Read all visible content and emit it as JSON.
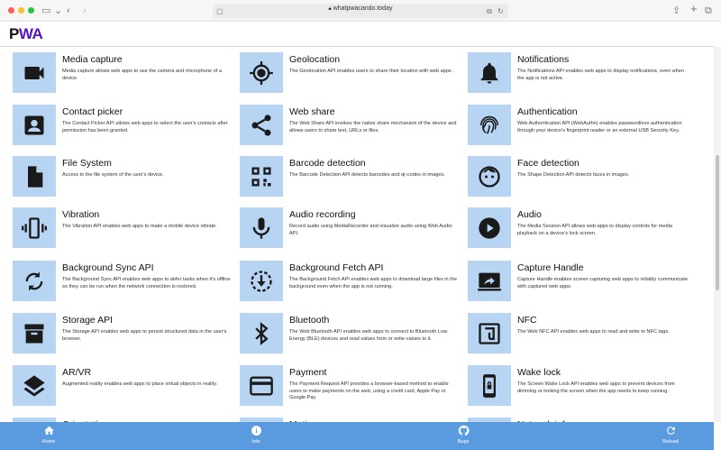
{
  "browser": {
    "url": "whatpwacando.today"
  },
  "app": {
    "logo_text_a": "P",
    "logo_text_b": "WA"
  },
  "colors": {
    "tile_bg": "#b7d5f3",
    "bottom_nav_bg": "#5a9be0",
    "icon": "#1a1a1a"
  },
  "features": [
    {
      "title": "Media capture",
      "desc": "Media capture allows web apps to use the camera and microphone of a device",
      "icon": "videocam-icon"
    },
    {
      "title": "Geolocation",
      "desc": "The Geolocation API enables users to share their location with web apps .",
      "icon": "gps-icon"
    },
    {
      "title": "Notifications",
      "desc": "The Notifications API enables web apps to display notifications, even when the app is not active.",
      "icon": "bell-icon"
    },
    {
      "title": "Contact picker",
      "desc": "The Contact Picker API allows web apps to select the user's contacts after permission has been granted.",
      "icon": "contact-icon"
    },
    {
      "title": "Web share",
      "desc": "The Web Share API invokes the native share mechanism of the device and allows users to share text, URLs or files.",
      "icon": "share-icon"
    },
    {
      "title": "Authentication",
      "desc": "Web Authentication API (WebAuthn) enables passwordless authentication through your device's fingerprint reader or an external USB Security Key.",
      "icon": "fingerprint-icon"
    },
    {
      "title": "File System",
      "desc": "Access to the file system of the user's device.",
      "icon": "file-icon"
    },
    {
      "title": "Barcode detection",
      "desc": "The Barcode Detection API detects barcodes and qr-codes in images.",
      "icon": "qr-code-icon"
    },
    {
      "title": "Face detection",
      "desc": "The Shape Detection API detects faces in images.",
      "icon": "face-icon"
    },
    {
      "title": "Vibration",
      "desc": "The Vibration API enables web apps to make a mobile device vibrate.",
      "icon": "vibration-icon"
    },
    {
      "title": "Audio recording",
      "desc": "Record audio using MediaRecorder and visualize audio using Web Audio API.",
      "icon": "microphone-icon"
    },
    {
      "title": "Audio",
      "desc": "The Media Session API allows web apps to display controls for media playback on a device's lock screen.",
      "icon": "play-icon"
    },
    {
      "title": "Background Sync API",
      "desc": "The Background Sync API enables web apps to defer tasks when it's offline so they can be run when the network connection is restored.",
      "icon": "sync-icon"
    },
    {
      "title": "Background Fetch API",
      "desc": "The Background Fetch API enables web apps to download large files in the background even when the app is not running.",
      "icon": "download-icon"
    },
    {
      "title": "Capture Handle",
      "desc": "Capture Handle enables screen capturing web apps to reliably communicate with captured web apps.",
      "icon": "screen-share-icon"
    },
    {
      "title": "Storage API",
      "desc": "The Storage API enables web apps to persist structured data in the user's browser.",
      "icon": "archive-icon"
    },
    {
      "title": "Bluetooth",
      "desc": "The Web Bluetooth API enables web apps to connect to Bluetooth Low Energy (BLE) devices and read values from or write values to it.",
      "icon": "bluetooth-icon"
    },
    {
      "title": "NFC",
      "desc": "The Web NFC API enables web apps to read and write to NFC tags.",
      "icon": "nfc-icon"
    },
    {
      "title": "AR/VR",
      "desc": "Augmented reality enables web apps to place virtual objects in reality.",
      "icon": "layers-icon"
    },
    {
      "title": "Payment",
      "desc": "The Payment Request API provides a browser-based method to enable users to make payments on the web, using a credit card, Apple Pay or Google Pay.",
      "icon": "credit-card-icon"
    },
    {
      "title": "Wake lock",
      "desc": "The Screen Wake Lock API enables web apps to prevent devices from dimming or locking the screen when the app needs to keep running.",
      "icon": "phone-lock-icon"
    },
    {
      "title": "Orientation",
      "desc": "",
      "icon": "screen-rotation-icon"
    },
    {
      "title": "Motion",
      "desc": "",
      "icon": "motion-icon"
    },
    {
      "title": "Network info",
      "desc": "",
      "icon": "network-icon"
    }
  ],
  "bottom_nav": [
    {
      "label": "Home",
      "icon": "home-icon"
    },
    {
      "label": "Info",
      "icon": "info-icon"
    },
    {
      "label": "Bugs",
      "icon": "github-icon"
    },
    {
      "label": "Reload",
      "icon": "reload-icon"
    }
  ]
}
